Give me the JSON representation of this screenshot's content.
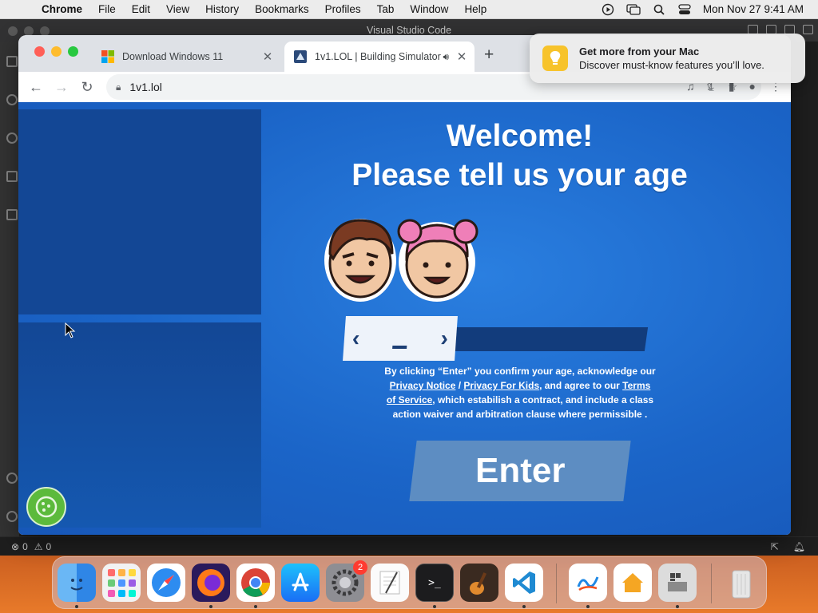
{
  "menubar": {
    "app_name": "Chrome",
    "items": [
      "File",
      "Edit",
      "View",
      "History",
      "Bookmarks",
      "Profiles",
      "Tab",
      "Window",
      "Help"
    ],
    "clock": "Mon Nov 27  9:41 AM"
  },
  "vscode": {
    "title": "Visual Studio Code",
    "status": {
      "errors": "0",
      "warnings": "0"
    }
  },
  "chrome": {
    "tabs": [
      {
        "title": "Download Windows 11",
        "favicon": "windows-logo-icon"
      },
      {
        "title": "1v1.LOL | Building Simulator",
        "favicon": "1v1lol-favicon",
        "audio": "speaker-icon"
      }
    ],
    "address": "1v1.lol"
  },
  "page": {
    "welcome_line1": "Welcome!",
    "welcome_line2": "Please tell us your age",
    "age_value": "_",
    "consent": {
      "part1": "By clicking “Enter” you confirm your age, acknowledge our",
      "privacy_notice": "Privacy Notice",
      "slash": "/",
      "privacy_kids": "Privacy For Kids",
      "part2": ", and agree to our",
      "terms": "Terms of Service",
      "part3": ", which estabilish a contract, and include a class action waiver and arbitration clause where permissible ."
    },
    "enter_label": "Enter"
  },
  "notification": {
    "title": "Get more from your Mac",
    "body": "Discover must-know features you’ll love."
  },
  "dock": {
    "apps": [
      "Finder",
      "Launchpad",
      "Safari",
      "Firefox",
      "Google Chrome",
      "App Store",
      "System Settings",
      "TextEdit",
      "Terminal",
      "GarageBand",
      "Visual Studio Code",
      "Freeform",
      "Home",
      "Boot Camp Assistant",
      "Trash"
    ],
    "settings_badge": "2"
  },
  "colors": {
    "page_blue": "#1b65c8",
    "side_panel": "#134795",
    "enter_button": "#5d8dc2",
    "cookie_button": "#5cba3c"
  }
}
